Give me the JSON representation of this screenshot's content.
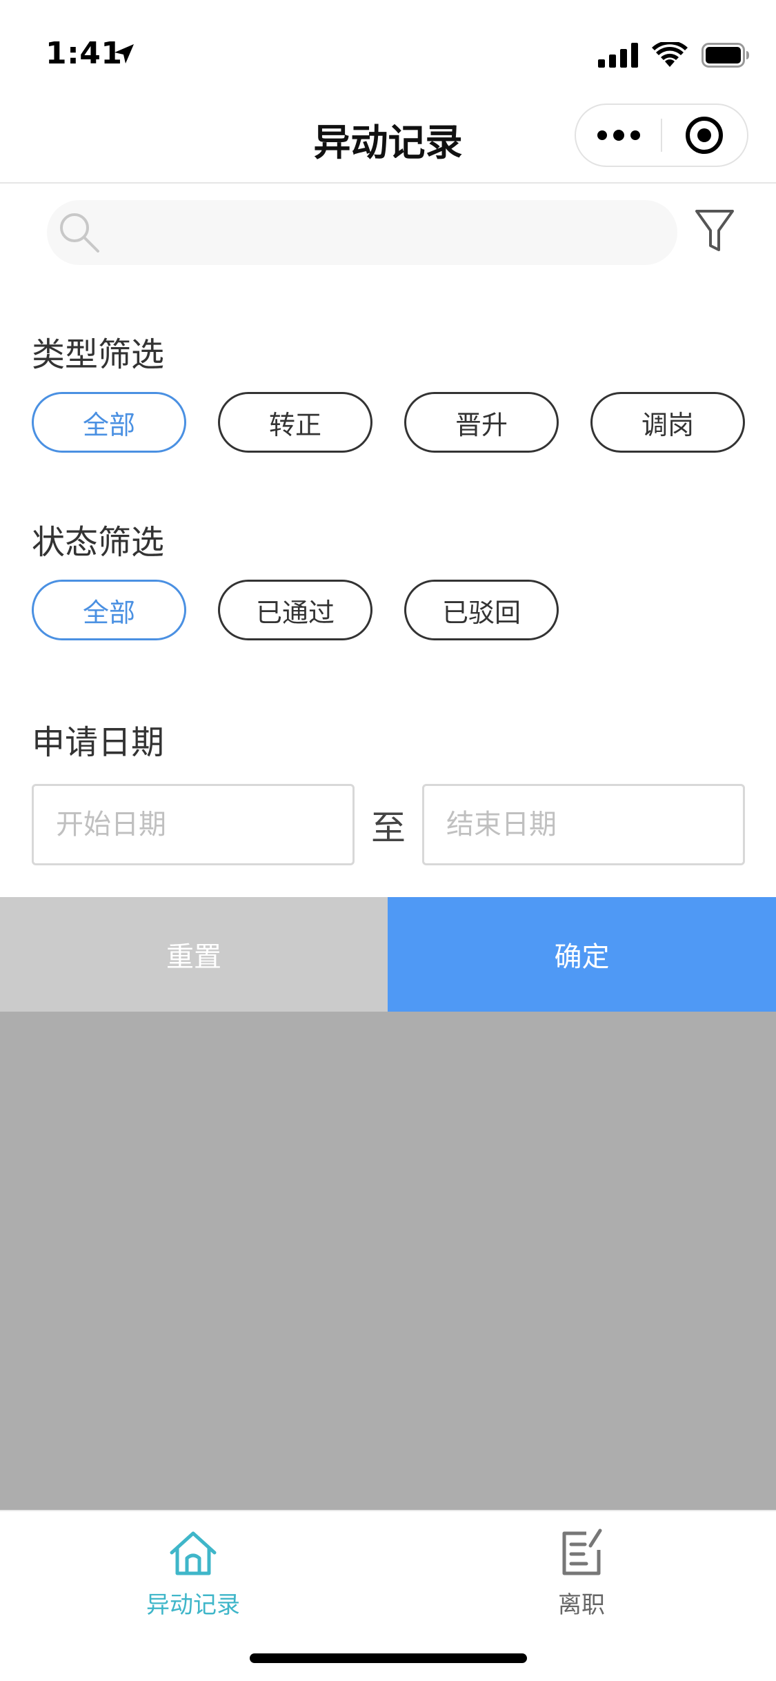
{
  "status_bar": {
    "time": "1:41"
  },
  "nav": {
    "title": "异动记录"
  },
  "search": {
    "placeholder": ""
  },
  "filters": {
    "type_title": "类型筛选",
    "type_options": [
      {
        "label": "全部",
        "active": true
      },
      {
        "label": "转正",
        "active": false
      },
      {
        "label": "晋升",
        "active": false
      },
      {
        "label": "调岗",
        "active": false
      }
    ],
    "status_title": "状态筛选",
    "status_options": [
      {
        "label": "全部",
        "active": true
      },
      {
        "label": "已通过",
        "active": false
      },
      {
        "label": "已驳回",
        "active": false
      }
    ],
    "date_title": "申请日期",
    "date_start_placeholder": "开始日期",
    "date_separator": "至",
    "date_end_placeholder": "结束日期"
  },
  "actions": {
    "reset_label": "重置",
    "confirm_label": "确定"
  },
  "tabbar": {
    "items": [
      {
        "label": "异动记录",
        "icon": "home-icon",
        "active": true
      },
      {
        "label": "离职",
        "icon": "edit-icon",
        "active": false
      }
    ]
  },
  "colors": {
    "accent_blue": "#4a90e2",
    "confirm_blue": "#4f99f5",
    "reset_gray": "#cbcbcb",
    "overlay_gray": "#adadad",
    "tab_active_teal": "#3fb6c9"
  }
}
